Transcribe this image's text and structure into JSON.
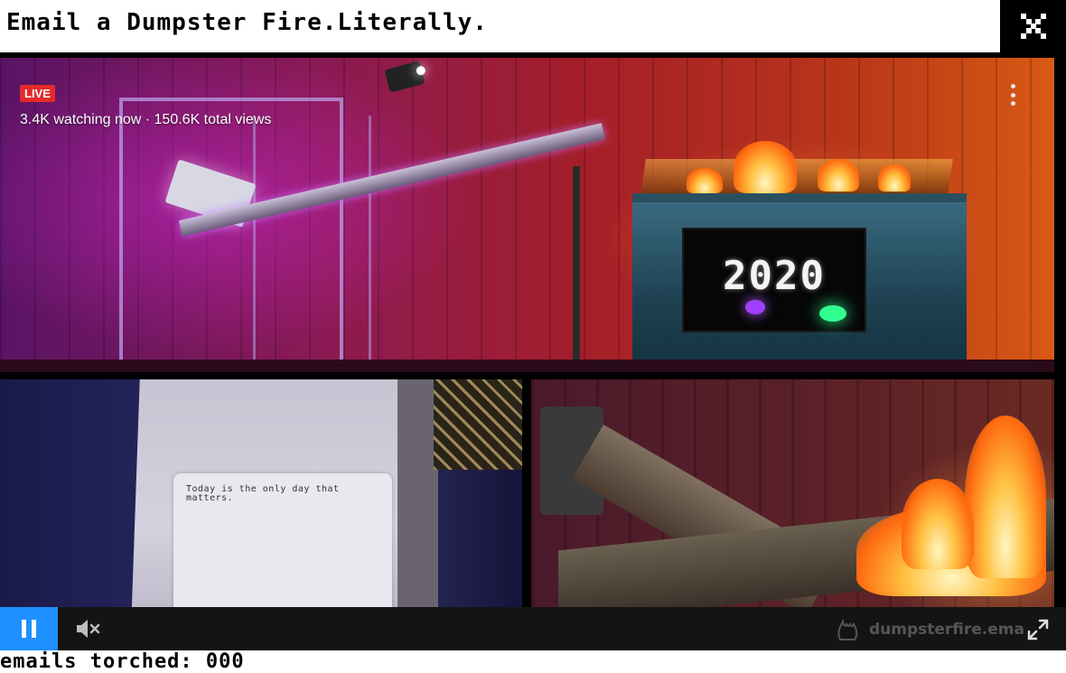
{
  "header": {
    "title": "Email a Dumpster Fire.Literally.",
    "close_icon": "close-x-icon"
  },
  "stream": {
    "live_badge": "LIVE",
    "viewers": "3.4K watching now · 150.6K total views",
    "menu_icon": "more-vertical-icon",
    "dumpster_screen_text": "2020",
    "paper_text": "Today is the only day that matters."
  },
  "controls": {
    "play_icon": "pause-icon",
    "mute_icon": "volume-muted-icon",
    "watermark": "dumpsterfire.ema",
    "watermark_icon": "fire-hand-icon",
    "fullscreen_icon": "fullscreen-icon"
  },
  "footer": {
    "counter": "emails torched: 000"
  },
  "colors": {
    "accent": "#1e90ff",
    "live": "#e42a2a",
    "background": "#ffffff",
    "player": "#000000"
  }
}
